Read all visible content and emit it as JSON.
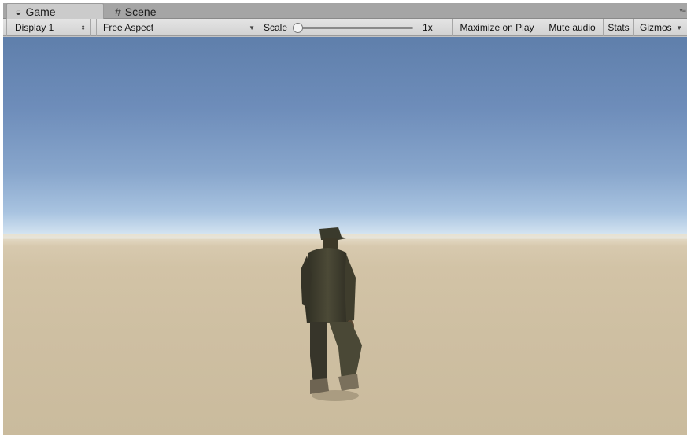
{
  "tabs": [
    {
      "label": "Game",
      "icon": "pacman-icon",
      "active": true
    },
    {
      "label": "Scene",
      "icon": "grid-icon",
      "active": false
    }
  ],
  "toolbar": {
    "display": "Display 1",
    "aspect": "Free Aspect",
    "scale_label": "Scale",
    "scale_value": "1x",
    "maximize": "Maximize on Play",
    "mute": "Mute audio",
    "stats": "Stats",
    "gizmos": "Gizmos"
  },
  "colors": {
    "sky_top": "#5f7fab",
    "horizon": "#e6eef4",
    "ground": "#cebfa2"
  }
}
